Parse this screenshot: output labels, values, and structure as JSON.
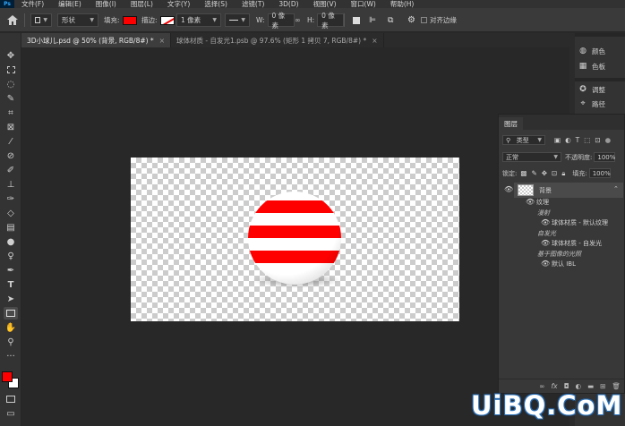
{
  "menu": {
    "logo": "Ps",
    "items": [
      "文件(F)",
      "编辑(E)",
      "图像(I)",
      "图层(L)",
      "文字(Y)",
      "选择(S)",
      "滤镜(T)",
      "3D(D)",
      "视图(V)",
      "窗口(W)",
      "帮助(H)"
    ]
  },
  "options": {
    "mode": "形状",
    "fill_label": "填充:",
    "stroke_label": "描边:",
    "stroke_width": "1 像素",
    "w_label": "W:",
    "w_value": "0 像素",
    "h_label": "H:",
    "h_value": "0 像素",
    "align_edges": "对齐边缘",
    "fill_color": "#ff0000"
  },
  "tabs": [
    {
      "label": "3D小球儿.psd @ 50% (背景, RGB/8#) *",
      "close": "×"
    },
    {
      "label": "球体材质 - 自发光1.psb @ 97.6% (矩形 1 拷贝 7, RGB/8#) *",
      "close": "×"
    }
  ],
  "side_panel": {
    "items": [
      "颜色",
      "色板",
      "调整",
      "路径"
    ]
  },
  "layers": {
    "tab": "图层",
    "filter_kind": "类型",
    "blend_mode": "正常",
    "opacity_label": "不透明度:",
    "opacity_value": "100%",
    "lock_label": "锁定:",
    "fill_label": "填充:",
    "fill_value": "100%",
    "rows": {
      "bg": "背景",
      "texture": "纹理",
      "diffuse": "漫射",
      "mat_default": "球体材质 - 默认纹理",
      "self_illum": "自发光",
      "mat_glow": "球体材质 - 自发光",
      "ibl_group": "基于图像的光照",
      "ibl_default": "默认 IBL"
    }
  },
  "watermark": "UiBQ.CoM",
  "colors": {
    "stripe_red": "#ff0000",
    "foreground": "#ff0000",
    "background": "#ffffff"
  }
}
